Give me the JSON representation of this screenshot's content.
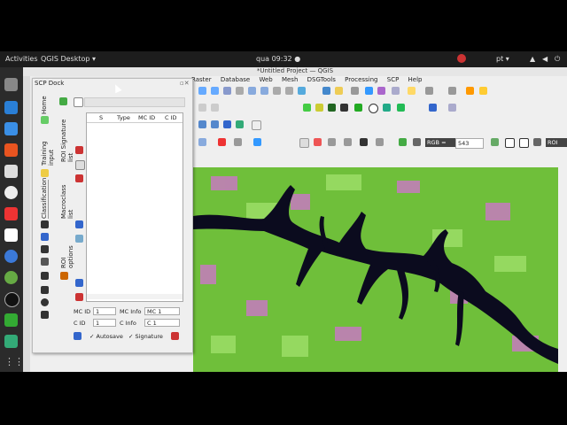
{
  "topbar": {
    "activities": "Activities",
    "app": "QGIS Desktop ▾",
    "clock": "qua 09:32 ●",
    "lang": "pt ▾"
  },
  "window": {
    "title": "*Untitled Project — QGIS"
  },
  "menu": [
    "Raster",
    "Database",
    "Web",
    "Mesh",
    "DSGTools",
    "Processing",
    "SCP",
    "Help"
  ],
  "toolbar": {
    "rgb_label": "RGB =",
    "rgb_value": "543",
    "roi_label": "ROI"
  },
  "scp": {
    "title": "SCP Dock",
    "tabs": [
      "Home",
      "Training input",
      "Classification"
    ],
    "subtabs": [
      "ROI Signature list",
      "Macroclass list",
      "ROI options"
    ],
    "columns": [
      "S",
      "Type",
      "MC ID",
      "C ID"
    ],
    "mc_id_label": "MC ID",
    "mc_id_value": "1",
    "mc_info_label": "MC Info",
    "mc_info_value": "MC 1",
    "c_id_label": "C ID",
    "c_id_value": "1",
    "c_info_label": "C Info",
    "c_info_value": "C 1",
    "autosave_label": "Autosave",
    "signature_label": "Signature"
  },
  "colors": {
    "map_vegetation": "#6fbf3a",
    "map_water": "#0b0b1e",
    "map_pink": "#c77ac0"
  }
}
